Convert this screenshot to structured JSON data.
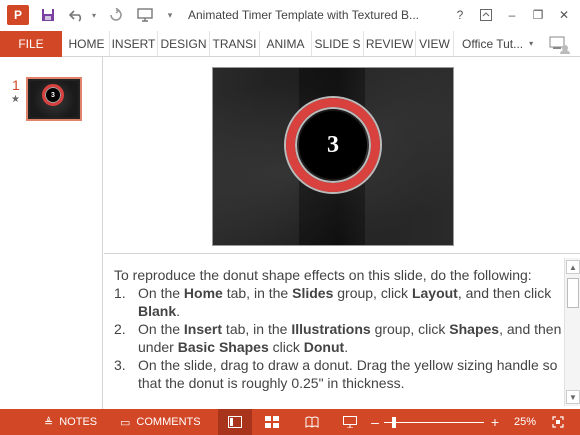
{
  "titlebar": {
    "app_logo": "P",
    "title": "Animated Timer Template with Textured B...",
    "help": "?",
    "minimize": "–",
    "restore": "❐",
    "close": "✕"
  },
  "ribbon": {
    "file": "FILE",
    "tabs": [
      "HOME",
      "INSERT",
      "DESIGN",
      "TRANSI",
      "ANIMA",
      "SLIDE S",
      "REVIEW",
      "VIEW"
    ],
    "account": "Office Tut..."
  },
  "thumbnails": {
    "slide_number": "1",
    "star": "★",
    "thumb_number": "3"
  },
  "slide": {
    "number_text": "3"
  },
  "notes": {
    "intro": "To reproduce the donut shape effects on this slide, do the following:",
    "steps": [
      {
        "num": "1.",
        "text_html": "On the <b>Home</b> tab, in the <b>Slides</b> group, click <b>Layout</b>, and then click <b>Blank</b>."
      },
      {
        "num": "2.",
        "text_html": "On the <b>Insert</b> tab, in the <b>Illustrations</b> group, click <b>Shapes</b>, and then under <b>Basic Shapes</b> click <b>Donut</b>."
      },
      {
        "num": "3.",
        "text_html": "On the slide, drag to draw a donut. Drag the yellow sizing handle so that the donut is roughly 0.25\" in thickness."
      }
    ]
  },
  "statusbar": {
    "notes": "NOTES",
    "comments": "COMMENTS",
    "zoom_minus": "–",
    "zoom_plus": "+",
    "zoom_level": "25%",
    "zoom_fraction": 0.25
  },
  "colors": {
    "accent": "#d24726",
    "donut_ring": "#d8413d"
  }
}
